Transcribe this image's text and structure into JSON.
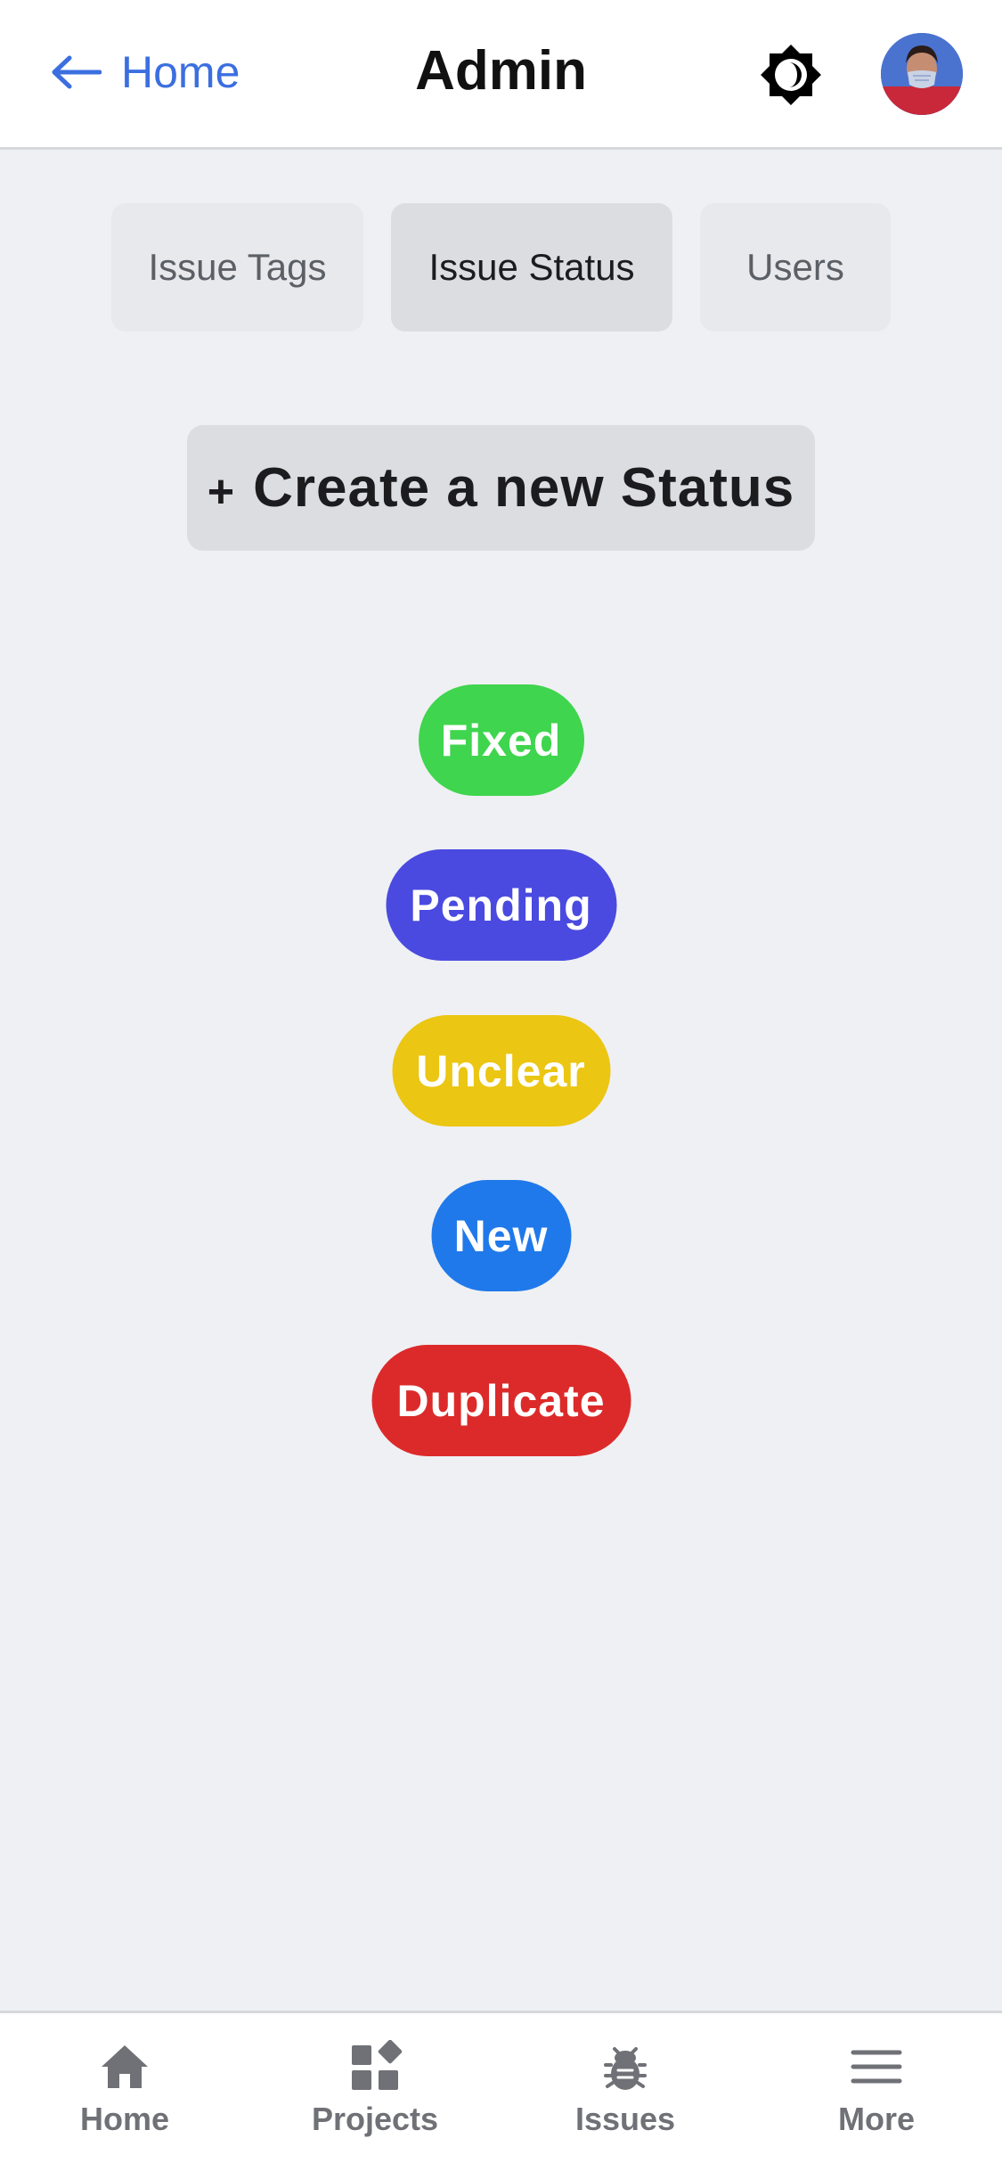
{
  "header": {
    "back_label": "Home",
    "title": "Admin",
    "theme_icon": "brightness-icon",
    "avatar_icon": "user-avatar"
  },
  "tabs": [
    {
      "label": "Issue Tags",
      "active": false
    },
    {
      "label": "Issue Status",
      "active": true
    },
    {
      "label": "Users",
      "active": false
    }
  ],
  "create_button": {
    "plus": "+",
    "label": "Create a new Status"
  },
  "statuses": [
    {
      "label": "Fixed",
      "color": "#3fd54e"
    },
    {
      "label": "Pending",
      "color": "#4a4ae0"
    },
    {
      "label": "Unclear",
      "color": "#ebc612"
    },
    {
      "label": "New",
      "color": "#2079ea"
    },
    {
      "label": "Duplicate",
      "color": "#dc2a2a"
    }
  ],
  "bottom_nav": [
    {
      "label": "Home",
      "icon": "home-icon"
    },
    {
      "label": "Projects",
      "icon": "projects-icon"
    },
    {
      "label": "Issues",
      "icon": "bug-icon"
    },
    {
      "label": "More",
      "icon": "menu-icon"
    }
  ],
  "colors": {
    "accent": "#3b6fe0",
    "background": "#eff0f3"
  }
}
